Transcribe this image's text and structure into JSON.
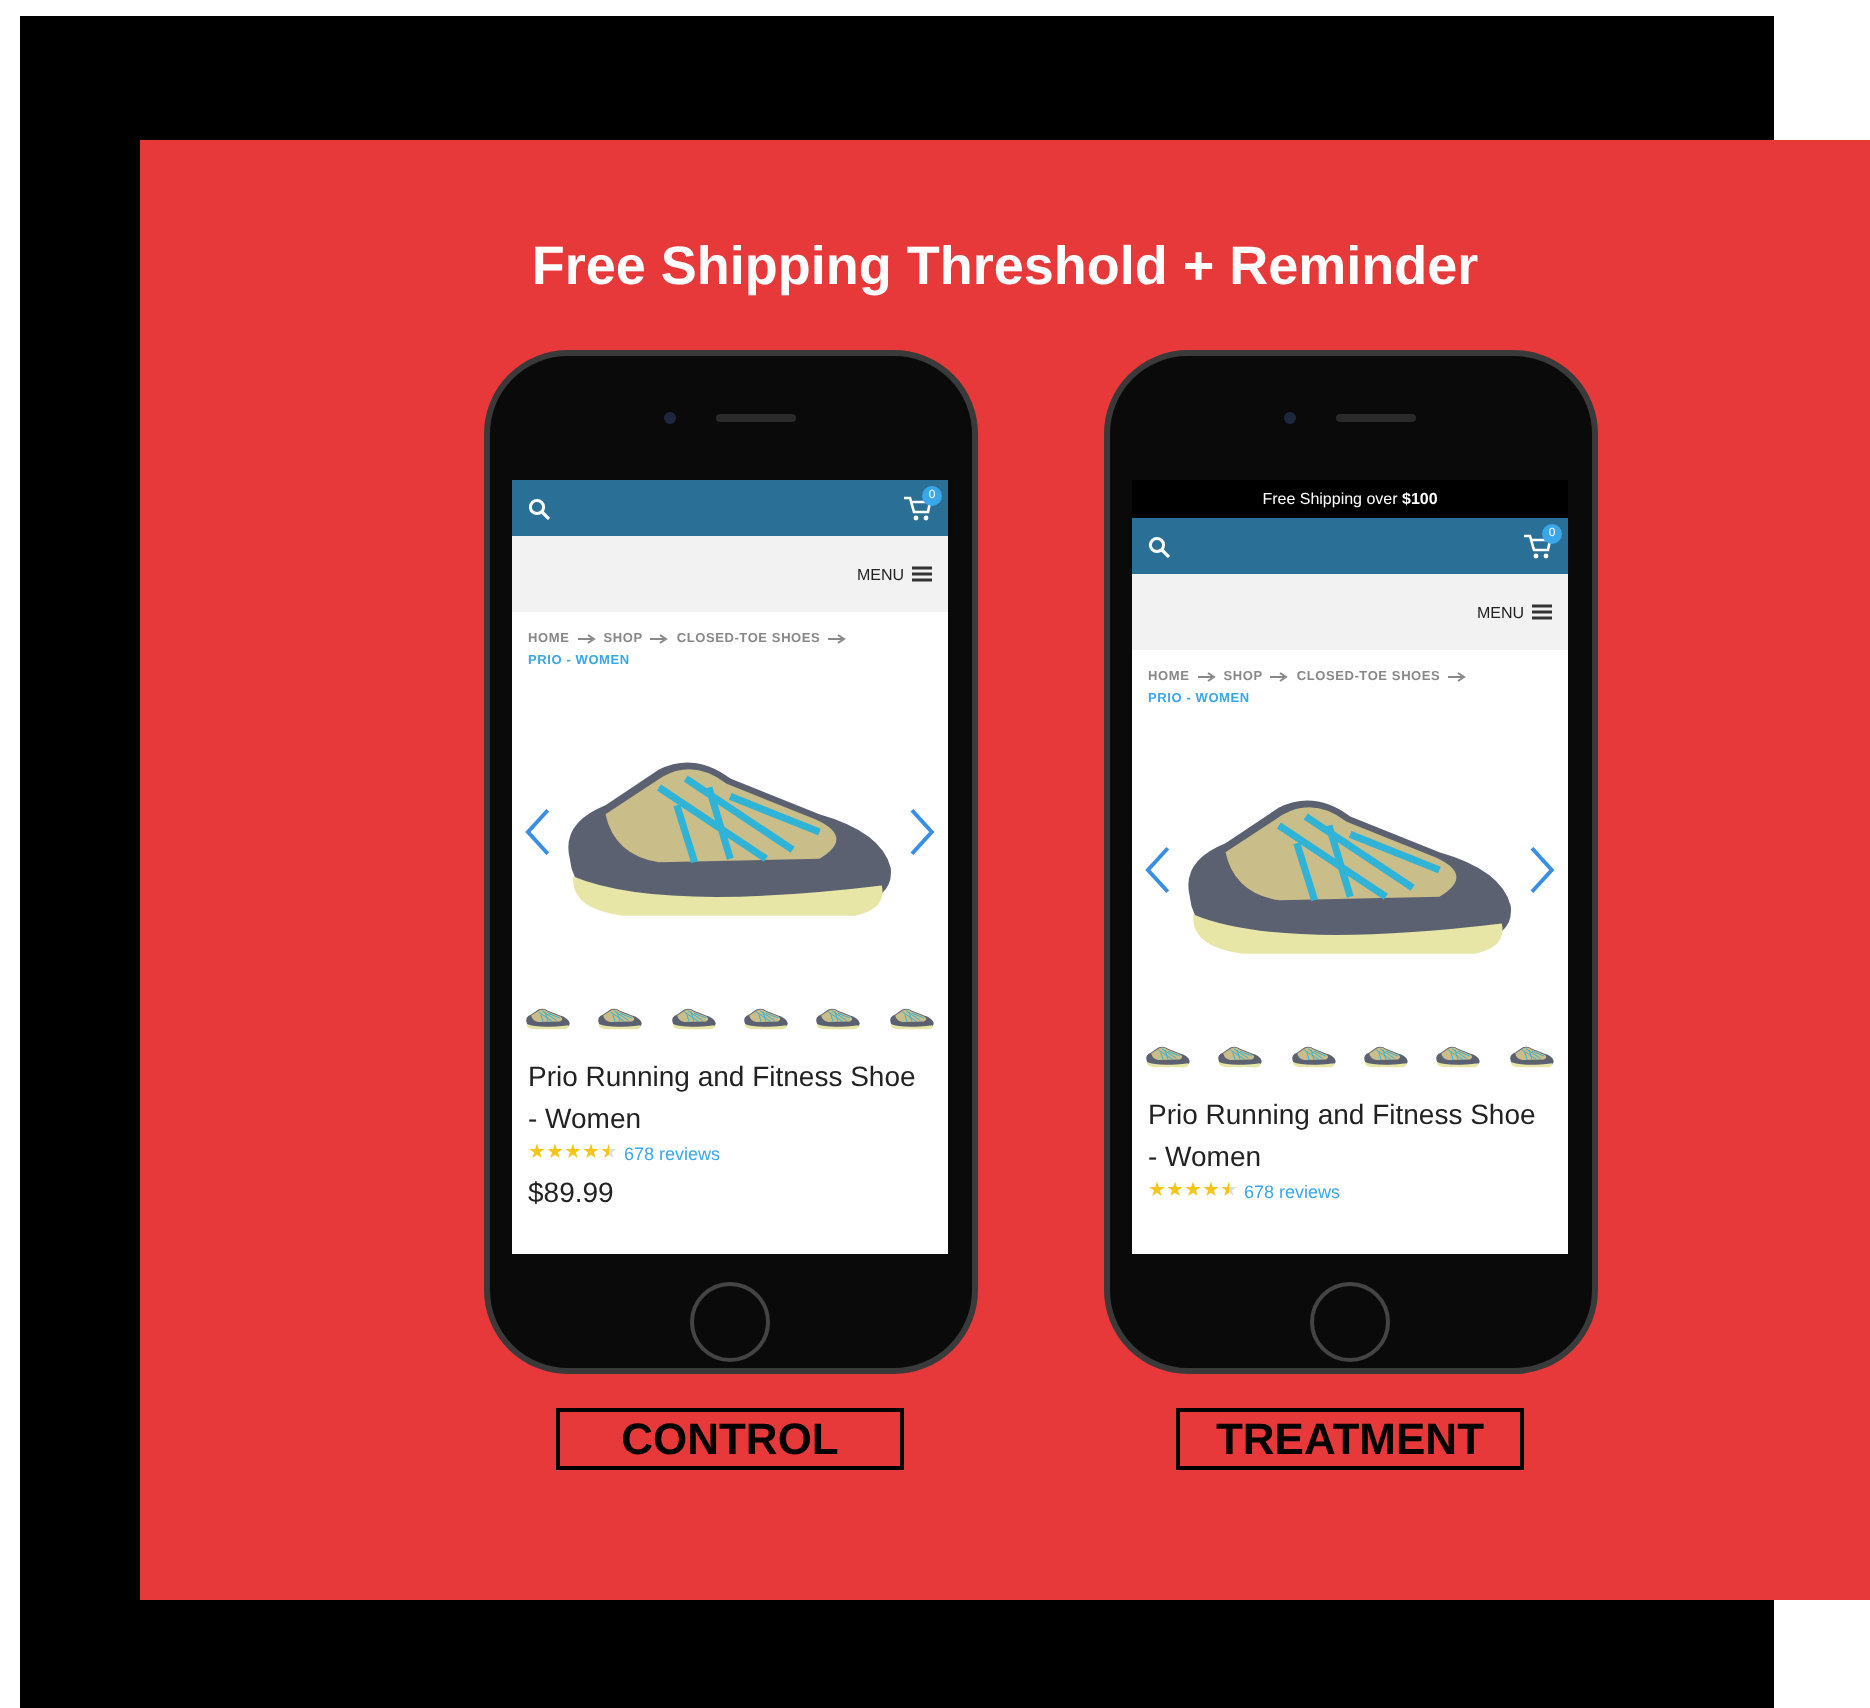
{
  "title": "Free Shipping Threshold + Reminder",
  "variants": [
    {
      "label": "CONTROL",
      "screen": {
        "cart_count": "0",
        "menu": "MENU",
        "breadcrumb": [
          {
            "label": "HOME",
            "current": false
          },
          {
            "label": "SHOP",
            "current": false
          },
          {
            "label": "CLOSED-TOE SHOES",
            "current": false
          },
          {
            "label": "PRIO - WOMEN",
            "current": true
          }
        ],
        "product_title": "Prio Running and Fitness Shoe - Women",
        "stars": 4.5,
        "reviews": "678 reviews",
        "price": "$89.99"
      }
    },
    {
      "label": "TREATMENT",
      "screen": {
        "announcement": "Free Shipping over **$100**",
        "cart_count": "0",
        "menu": "MENU",
        "breadcrumb": [
          {
            "label": "HOME",
            "current": false
          },
          {
            "label": "SHOP",
            "current": false
          },
          {
            "label": "CLOSED-TOE SHOES",
            "current": false
          },
          {
            "label": "PRIO - WOMEN",
            "current": true
          }
        ],
        "product_title": "Prio Running and Fitness Shoe - Women",
        "stars": 4.5,
        "reviews": "678 reviews"
      }
    }
  ]
}
